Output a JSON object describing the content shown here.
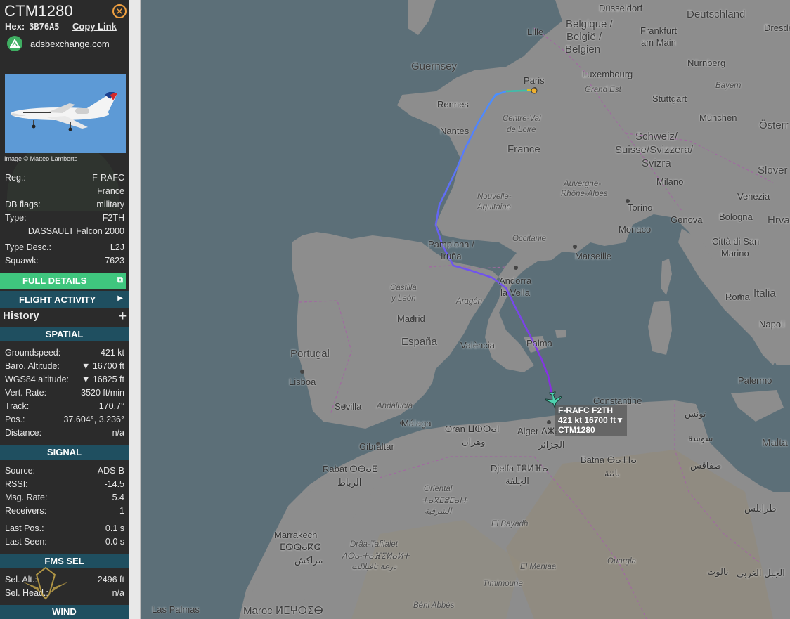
{
  "aircraft": {
    "callsign": "CTM1280",
    "hex_label": "Hex:",
    "hex": "3B76A5",
    "copy_link": "Copy Link",
    "site": "adsbexchange.com",
    "photo_credit": "Image © Matteo Lamberts"
  },
  "details": {
    "reg_label": "Reg.:",
    "reg": "F-RAFC",
    "country": "France",
    "flags_label": "DB flags:",
    "flags": "military",
    "type_label": "Type:",
    "type": "F2TH",
    "model": "DASSAULT Falcon 2000",
    "desc_label": "Type Desc.:",
    "desc": "L2J",
    "squawk_label": "Squawk:",
    "squawk": "7623"
  },
  "buttons": {
    "full_details": "FULL DETAILS",
    "flight_activity": "FLIGHT ACTIVITY",
    "history": "History"
  },
  "spatial": {
    "title": "SPATIAL",
    "rows": [
      {
        "label": "Groundspeed:",
        "value": "421 kt"
      },
      {
        "label": "Baro. Altitude:",
        "value": "▼ 16700 ft"
      },
      {
        "label": "WGS84 altitude:",
        "value": "▼ 16825 ft"
      },
      {
        "label": "Vert. Rate:",
        "value": "-3520 ft/min"
      },
      {
        "label": "Track:",
        "value": "170.7°"
      },
      {
        "label": "Pos.:",
        "value": "37.604°, 3.236°"
      },
      {
        "label": "Distance:",
        "value": "n/a"
      }
    ]
  },
  "signal": {
    "title": "SIGNAL",
    "rows": [
      {
        "label": "Source:",
        "value": "ADS-B"
      },
      {
        "label": "RSSI:",
        "value": "-14.5"
      },
      {
        "label": "Msg. Rate:",
        "value": "5.4"
      },
      {
        "label": "Receivers:",
        "value": "1"
      },
      {
        "label": "Last Pos.:",
        "value": "0.1 s"
      },
      {
        "label": "Last Seen:",
        "value": "0.0 s"
      }
    ]
  },
  "fms": {
    "title": "FMS SEL",
    "rows": [
      {
        "label": "Sel. Alt.:",
        "value": "2496 ft"
      },
      {
        "label": "Sel. Head.:",
        "value": "n/a"
      }
    ]
  },
  "wind": {
    "title": "WIND"
  },
  "plane_label": {
    "line1": "F-RAFC F2TH",
    "line2": "421 kt  16700 ft▼",
    "line3": "CTM1280"
  },
  "map_labels": {
    "dusseldorf": "Düsseldorf",
    "deutschland": "Deutschland",
    "dresden": "Dresden",
    "lille": "Lille",
    "belgique": "Belgique /",
    "belgie": "België /",
    "belgien": "Belgien",
    "frankfurt": "Frankfurt",
    "ammain": "am Main",
    "guernsey": "Guernsey",
    "luxembourg": "Luxembourg",
    "nurnberg": "Nürnberg",
    "paris": "Paris",
    "bayern": "Bayern",
    "grandest": "Grand Est",
    "rennes": "Rennes",
    "stuttgart": "Stuttgart",
    "centre": "Centre-Val",
    "deloire": "de Loire",
    "munchen": "München",
    "osterr": "Österr",
    "nantes": "Nantes",
    "france": "France",
    "schweiz": "Schweiz/",
    "suisse": "Suisse/Svizzera/",
    "svizra": "Svizra",
    "slover": "Slover",
    "auvergne": "Auvergne-",
    "rhone": "Rhône-Alpes",
    "milano": "Milano",
    "venezia": "Venezia",
    "nouvelle": "Nouvelle-",
    "aquitaine": "Aquitaine",
    "torino": "Torino",
    "genova": "Genova",
    "bologna": "Bologna",
    "hrva": "Hrva",
    "monaco": "Monaco",
    "occitanie": "Occitanie",
    "pamplona": "Pamplona /",
    "iruna": "Iruña",
    "marseille": "Marseille",
    "cittadisan": "Città di San",
    "marino": "Marino",
    "andorra": "Andorra",
    "lavella": "la Vella",
    "castilla": "Castilla",
    "yleon": "y León",
    "aragon": "Aragón",
    "italia": "Italia",
    "roma": "Roma",
    "madrid": "Madrid",
    "napoli": "Napoli",
    "portugal": "Portugal",
    "espana": "España",
    "valencia": "València",
    "palma": "Palma",
    "lisboa": "Lisboa",
    "palermo": "Palermo",
    "constantine": "Constantine",
    "sevilla": "Sevilla",
    "andalucia": "Andalucía",
    "tunis": "تونس",
    "malaga": "Málaga",
    "oran": "Oran ⵡⵀⵔⴰⵏ",
    "wahran": "وهران",
    "alger": "Alger ⴷⵣⴰⵢⴻⵔ",
    "jazair": "الجزائر",
    "susa": "سوسة",
    "malta": "Malta",
    "gibraltar": "Gibraltar",
    "rabat": "Rabat ⵔⴱⴰⵟ",
    "ribat": "الرباط",
    "batna": "Batna ⴱⴰⵜⵏⴰ",
    "batna_ar": "باتنة",
    "safaqis": "صفاقس",
    "djelfa": "Djelfa ⵊⴻⵍⴼⴰ",
    "jelfa_ar": "الجلفة",
    "oriental": "Oriental",
    "oriental_tf": "ⵜⴰⴳⵎⵓⴹⴰⵏⵜ",
    "sharqiya": "الشرقية",
    "tarabulus": "طرابلس",
    "elbayadh": "El Bayadh",
    "marrakech": "Marrakech",
    "marrakech_tf": "ⵎⵕⵕⴰⴽⵛ",
    "marrakech_ar": "مراكش",
    "draa": "Drâa-Tafilalet",
    "draa_tf": "ⴷⵔⴰ-ⵜⴰⴼⵉⵍⴰⵍⵜ",
    "draa_ar": "درعة تافيلالت",
    "elmeniaa": "El Meniaa",
    "ouargla": "Ouargla",
    "jabal": "الجبل الغربي",
    "nalut": "نالوت",
    "timimoune": "Timimoune",
    "laspalmas": "Las Palmas",
    "beniabbes": "Béni Abbès",
    "maroc": "Maroc ⵍⵎⵖⵔⵉⴱ"
  }
}
